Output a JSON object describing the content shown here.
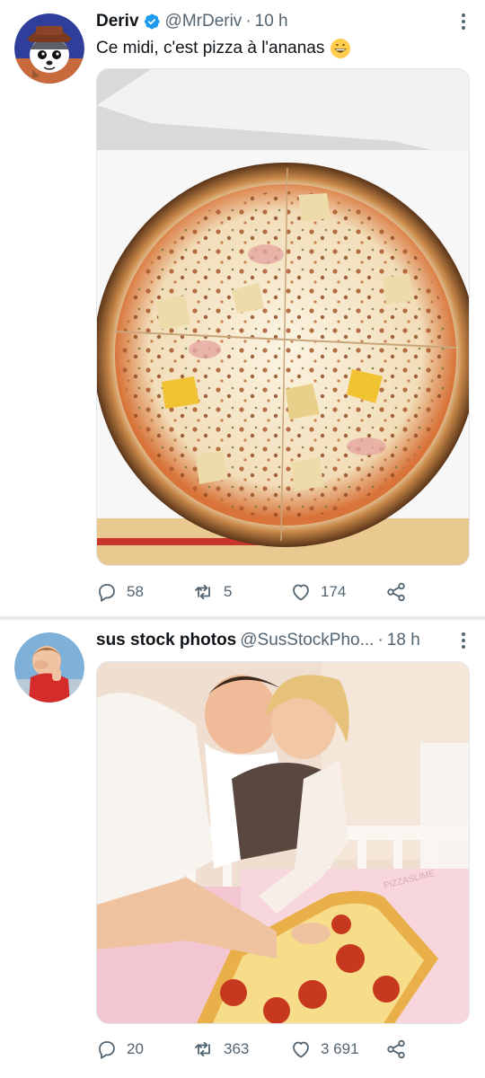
{
  "tweets": [
    {
      "name": "Deriv",
      "handle": "@MrDeriv",
      "separator": "·",
      "time": "10 h",
      "text": "Ce midi, c'est pizza à l'ananas",
      "verified": true,
      "emoji": "grinning-face-emoji",
      "media": "pineapple-pizza-in-box-photo",
      "stats": {
        "replies": "58",
        "retweets": "5",
        "likes": "174"
      }
    },
    {
      "name": "sus stock photos",
      "handle": "@SusStockPho...",
      "separator": "·",
      "time": "18 h",
      "verified": false,
      "media": "couple-with-pizza-in-crib-photo",
      "stats": {
        "replies": "20",
        "retweets": "363",
        "likes": "3 691"
      }
    }
  ],
  "photo_watermark": "PIZZASLIME",
  "colors": {
    "text": "#0f1419",
    "secondary": "#536471",
    "verified": "#1d9bf0",
    "separator": "#e7eaed",
    "background": "#ffffff"
  },
  "icons": [
    "reply-icon",
    "retweet-icon",
    "like-icon",
    "share-icon",
    "more-options-icon",
    "verified-badge-icon"
  ]
}
